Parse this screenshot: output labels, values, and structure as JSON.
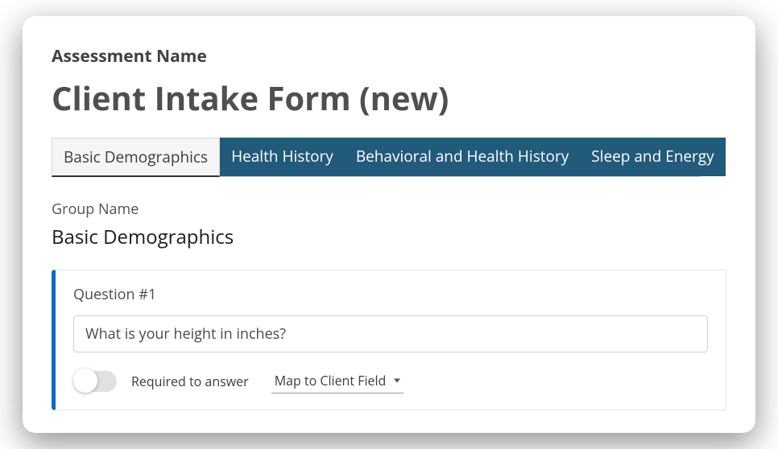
{
  "header": {
    "assessment_label": "Assessment Name",
    "assessment_title": "Client Intake Form (new)"
  },
  "tabs": [
    {
      "label": "Basic Demographics",
      "active": true
    },
    {
      "label": "Health History",
      "active": false
    },
    {
      "label": "Behavioral and Health History",
      "active": false
    },
    {
      "label": "Sleep and Energy",
      "active": false
    }
  ],
  "group": {
    "label": "Group Name",
    "title": "Basic Demographics"
  },
  "question": {
    "label": "Question #1",
    "value": "What is your height in inches?",
    "required_label": "Required to answer",
    "required": false,
    "map_label": "Map to Client Field"
  },
  "colors": {
    "tab_bg": "#215a7a",
    "accent": "#0b69c7"
  }
}
